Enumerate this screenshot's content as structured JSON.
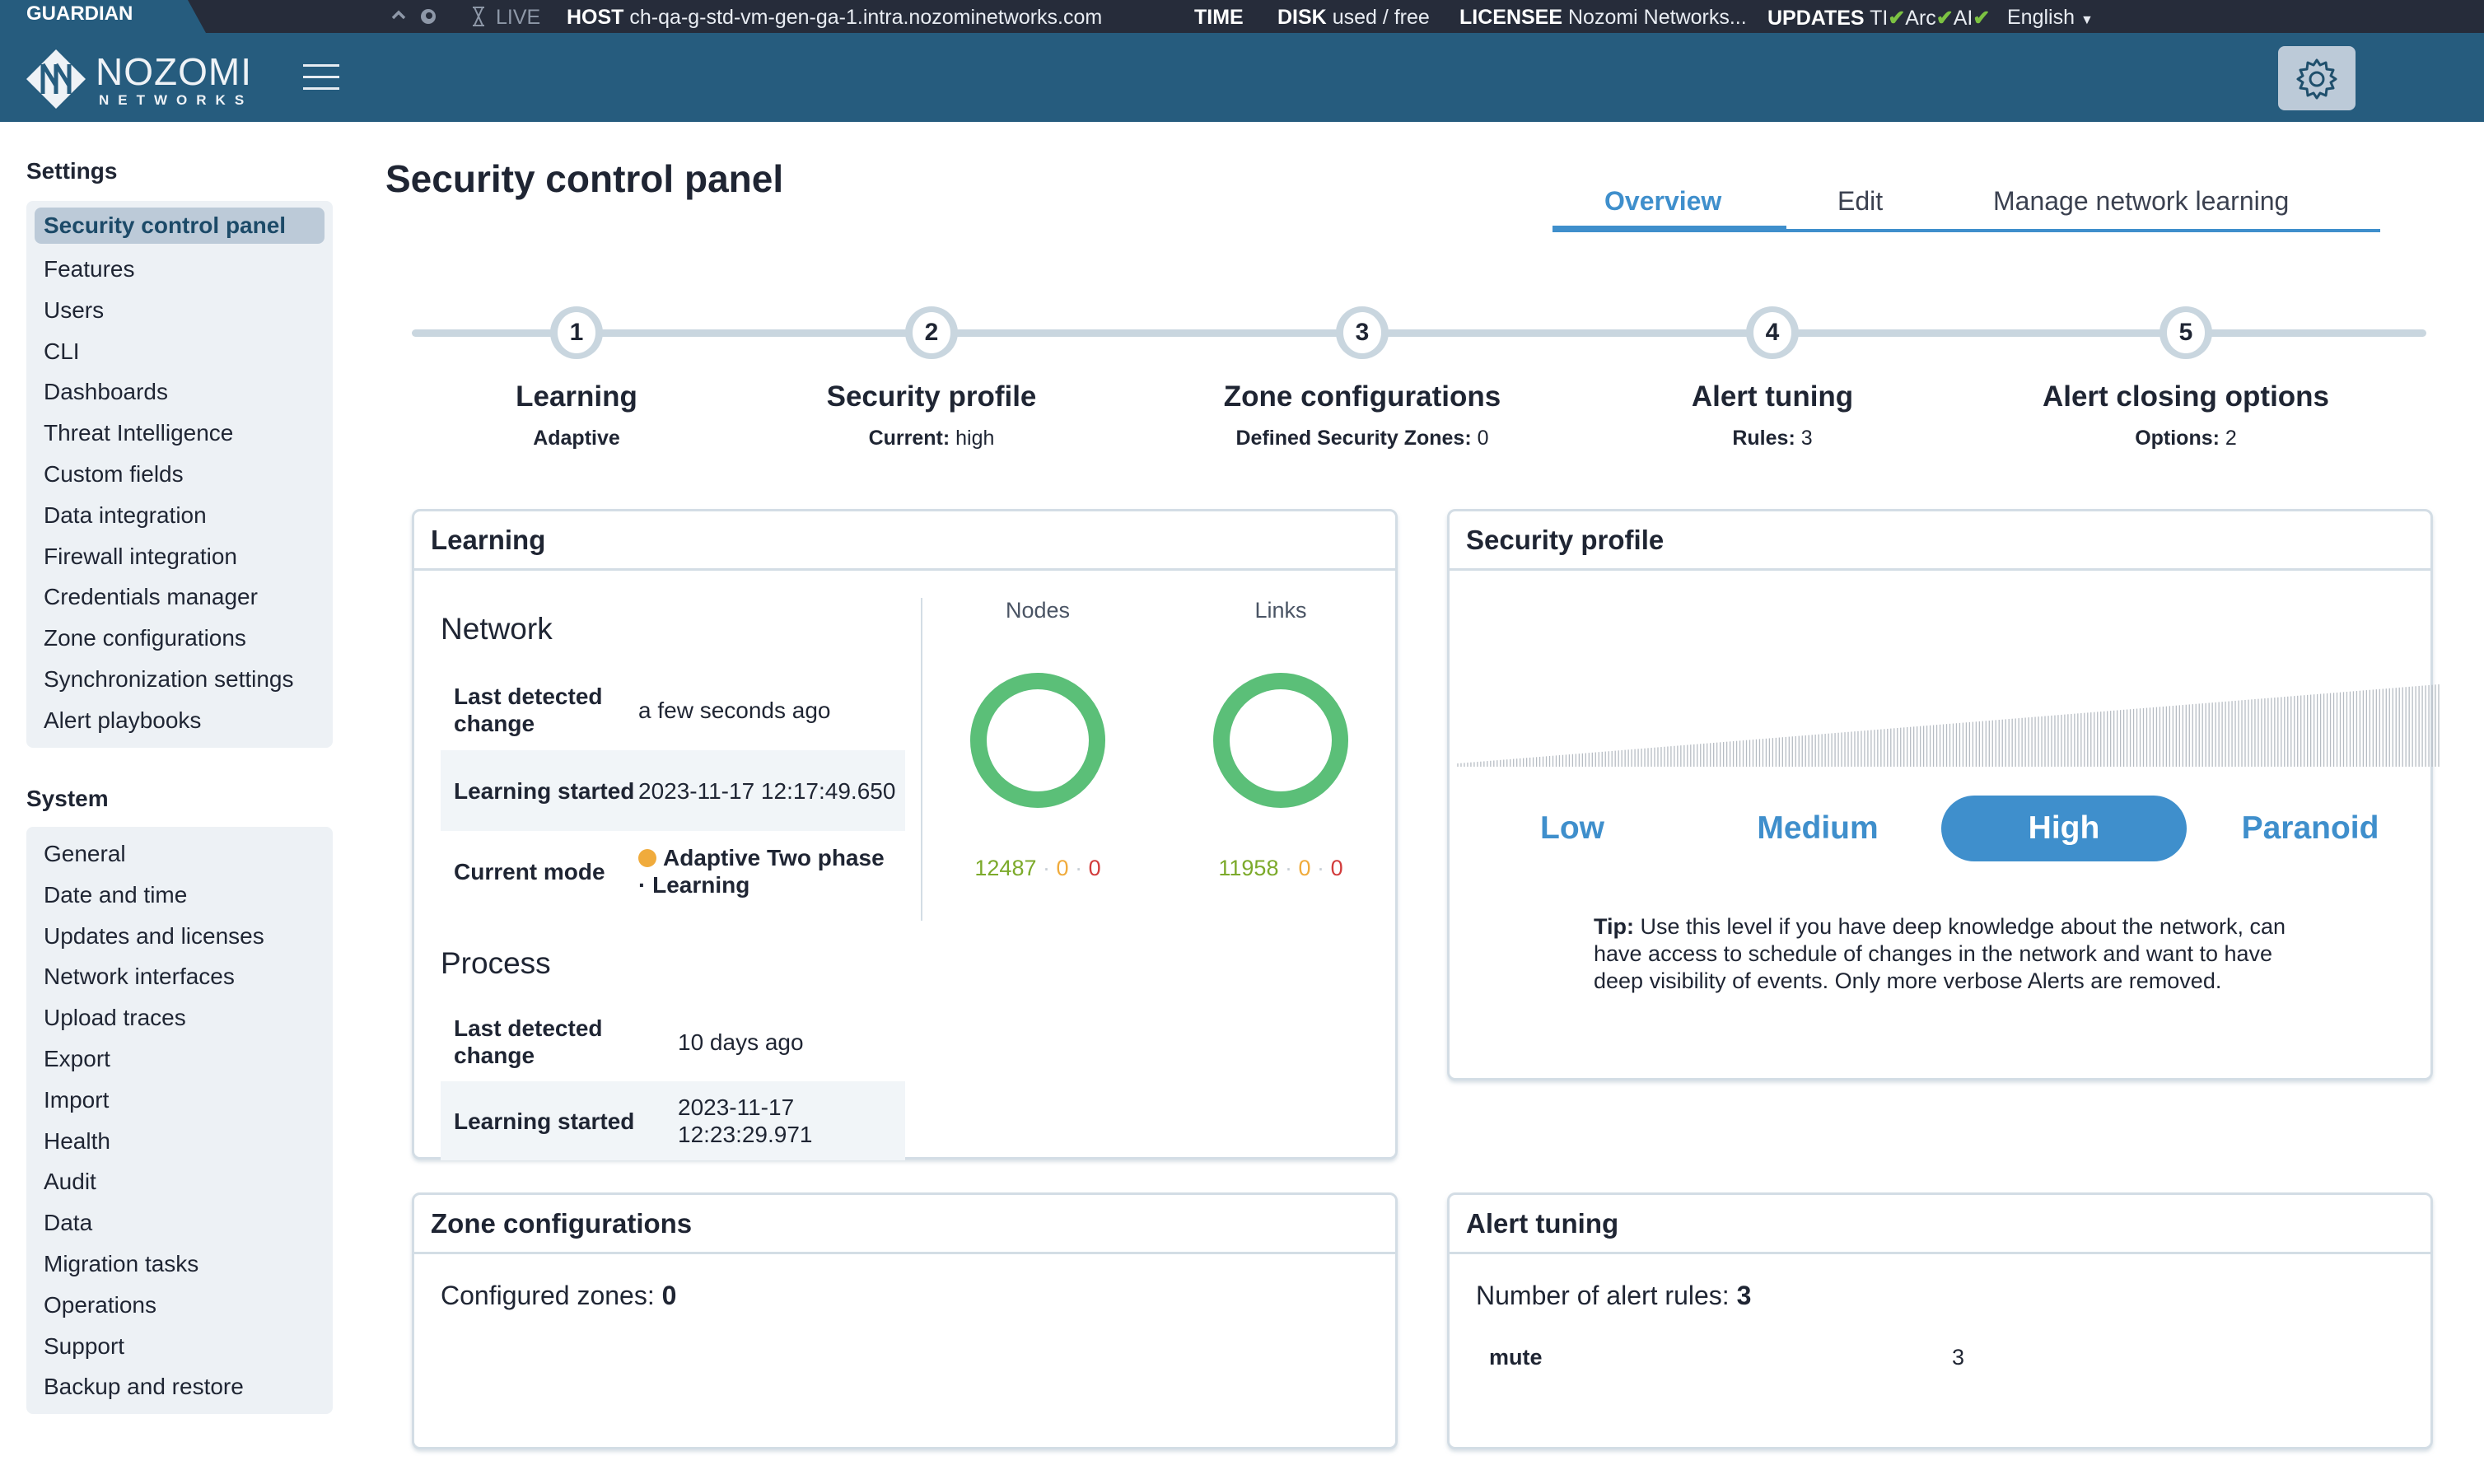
{
  "topbar": {
    "product": "GUARDIAN",
    "live_label": "LIVE",
    "host_label": "HOST",
    "host_value": "ch-qa-g-std-vm-gen-ga-1.intra.nozominetworks.com",
    "time_label": "TIME",
    "disk_label": "DISK",
    "disk_value": "used / free",
    "licensee_label": "LICENSEE",
    "licensee_value": "Nozomi Networks...",
    "updates_label": "UPDATES",
    "updates": [
      {
        "name": "TI",
        "status": "ok"
      },
      {
        "name": "Arc",
        "status": "ok"
      },
      {
        "name": "AI",
        "status": "ok"
      }
    ],
    "check_glyph": "✔",
    "language": "English",
    "status_ok_color": "#7cc242"
  },
  "header": {
    "logo_name": "NOZOMI",
    "logo_sub": "NETWORKS",
    "menu_icon": "hamburger-icon",
    "settings_icon": "gear-icon"
  },
  "sidebar": {
    "sections": [
      {
        "title": "Settings",
        "items": [
          {
            "label": "Security control panel",
            "active": true
          },
          {
            "label": "Features"
          },
          {
            "label": "Users"
          },
          {
            "label": "CLI"
          },
          {
            "label": "Dashboards"
          },
          {
            "label": "Threat Intelligence"
          },
          {
            "label": "Custom fields"
          },
          {
            "label": "Data integration"
          },
          {
            "label": "Firewall integration"
          },
          {
            "label": "Credentials manager"
          },
          {
            "label": "Zone configurations"
          },
          {
            "label": "Synchronization settings"
          },
          {
            "label": "Alert playbooks"
          }
        ]
      },
      {
        "title": "System",
        "items": [
          {
            "label": "General"
          },
          {
            "label": "Date and time"
          },
          {
            "label": "Updates and licenses"
          },
          {
            "label": "Network interfaces"
          },
          {
            "label": "Upload traces"
          },
          {
            "label": "Export"
          },
          {
            "label": "Import"
          },
          {
            "label": "Health"
          },
          {
            "label": "Audit"
          },
          {
            "label": "Data"
          },
          {
            "label": "Migration tasks"
          },
          {
            "label": "Operations"
          },
          {
            "label": "Support"
          },
          {
            "label": "Backup and restore"
          }
        ]
      }
    ]
  },
  "main": {
    "title": "Security control panel",
    "tabs": [
      {
        "label": "Overview",
        "active": true
      },
      {
        "label": "Edit"
      },
      {
        "label": "Manage network learning"
      }
    ],
    "accent_color": "#3f8fcc",
    "steps": [
      {
        "number": "1",
        "title": "Learning",
        "sub_label": "Adaptive",
        "sub_value": ""
      },
      {
        "number": "2",
        "title": "Security profile",
        "sub_label": "Current:",
        "sub_value": "high"
      },
      {
        "number": "3",
        "title": "Zone configurations",
        "sub_label": "Defined Security Zones:",
        "sub_value": "0"
      },
      {
        "number": "4",
        "title": "Alert tuning",
        "sub_label": "Rules:",
        "sub_value": "3"
      },
      {
        "number": "5",
        "title": "Alert closing options",
        "sub_label": "Options:",
        "sub_value": "2"
      }
    ],
    "learning": {
      "title": "Learning",
      "network": {
        "heading": "Network",
        "rows": [
          {
            "key": "Last detected change",
            "value": "a few seconds ago"
          },
          {
            "key": "Learning started",
            "value": "2023-11-17 12:17:49.650"
          },
          {
            "key": "Current mode",
            "value": "Adaptive Two phase · Learning",
            "status_color": "#f0ab3c"
          }
        ]
      },
      "process": {
        "heading": "Process",
        "rows": [
          {
            "key": "Last detected change",
            "value": "10 days ago"
          },
          {
            "key": "Learning started",
            "value": "2023-11-17 12:23:29.971"
          }
        ]
      },
      "nodes": {
        "label": "Nodes",
        "learned": "12487",
        "pending": "0",
        "unlearned": "0",
        "learned_fraction": 1.0
      },
      "links": {
        "label": "Links",
        "learned": "11958",
        "pending": "0",
        "unlearned": "0",
        "learned_fraction": 1.0
      },
      "donut_color": "#5bbf78"
    },
    "security_profile": {
      "title": "Security profile",
      "levels": [
        {
          "label": "Low"
        },
        {
          "label": "Medium"
        },
        {
          "label": "High",
          "active": true
        },
        {
          "label": "Paranoid"
        }
      ],
      "tip_label": "Tip:",
      "tip_text": "Use this level if you have deep knowledge about the network, can have access to schedule of changes in the network and want to have deep visibility of events. Only more verbose Alerts are removed."
    },
    "zone_configurations": {
      "title": "Zone configurations",
      "configured_label": "Configured zones:",
      "configured_value": "0"
    },
    "alert_tuning": {
      "title": "Alert tuning",
      "rules_label": "Number of alert rules:",
      "rules_value": "3",
      "rules": [
        {
          "action": "mute",
          "count": "3"
        }
      ]
    }
  }
}
